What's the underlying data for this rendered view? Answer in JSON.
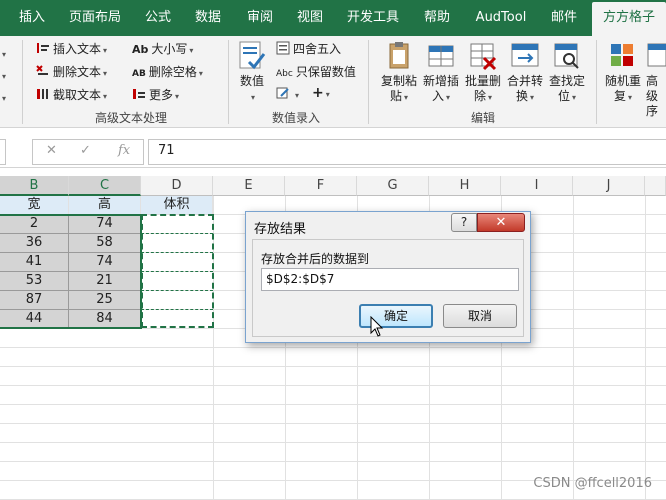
{
  "tabs": [
    "插入",
    "页面布局",
    "公式",
    "数据",
    "审阅",
    "视图",
    "开发工具",
    "帮助",
    "AudTool",
    "邮件",
    "方方格子"
  ],
  "ribbon": {
    "text_group": {
      "items_col1": [
        "插入文本",
        "删除文本",
        "截取文本"
      ],
      "items_col2": [
        "大小写",
        "删除空格",
        "更多"
      ],
      "icon_col2": [
        "Ab",
        "AB"
      ],
      "label": "高级文本处理"
    },
    "number_group": {
      "big_label": "数值",
      "items": [
        "四舍五入",
        "只保留数值"
      ],
      "icon_col": [
        "Abc"
      ],
      "plus": "+",
      "label": "数值录入"
    },
    "edit_group": {
      "buttons": [
        {
          "l1": "复制粘",
          "l2": "贴"
        },
        {
          "l1": "新增插",
          "l2": "入"
        },
        {
          "l1": "批量删",
          "l2": "除"
        },
        {
          "l1": "合并转",
          "l2": "换"
        },
        {
          "l1": "查找定",
          "l2": "位"
        }
      ],
      "label": "编辑"
    },
    "last_group": {
      "buttons": [
        {
          "l1": "随机重",
          "l2": "复"
        },
        {
          "l1": "高级",
          "l2": "序"
        }
      ]
    }
  },
  "formula_bar": {
    "cancel_icon": "cancel-x-icon",
    "enter_icon": "check-icon",
    "fx": "fx",
    "value": "71"
  },
  "grid": {
    "columns": [
      "B",
      "C",
      "D",
      "E",
      "F",
      "G",
      "H",
      "I",
      "J"
    ],
    "header_row": [
      "宽",
      "高",
      "体积"
    ],
    "rows": [
      [
        "2",
        "74"
      ],
      [
        "36",
        "58"
      ],
      [
        "41",
        "74"
      ],
      [
        "53",
        "21"
      ],
      [
        "87",
        "25"
      ],
      [
        "44",
        "84"
      ]
    ]
  },
  "dialog": {
    "title": "存放结果",
    "help": "?",
    "close": "✕",
    "label": "存放合并后的数据到",
    "range": "$D$2:$D$7",
    "ok": "确定",
    "cancel": "取消"
  },
  "watermark": "CSDN @ffcell2016",
  "colors": {
    "ribbon_green": "#217346",
    "header_fill": "#ddebf7",
    "selection_gray": "#d4d4d4"
  }
}
